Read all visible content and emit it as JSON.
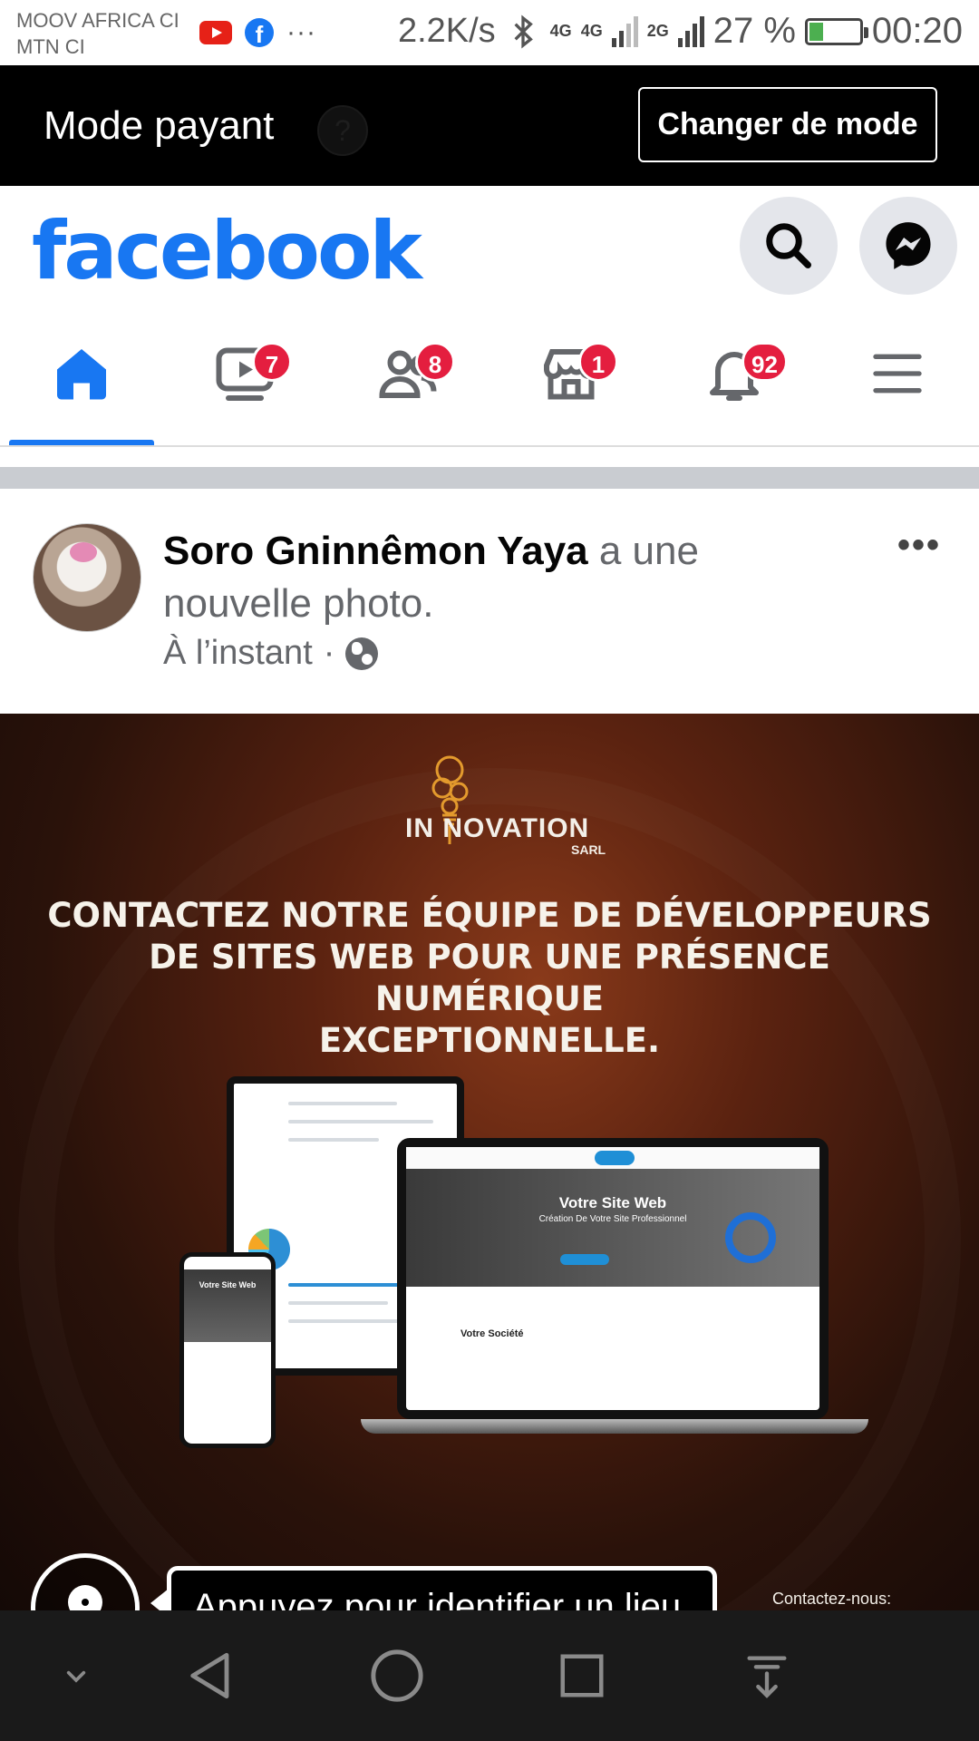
{
  "status_bar": {
    "carrier_1": "MOOV AFRICA CI",
    "carrier_2": "MTN CI",
    "speed": "2.2K/s",
    "net_1": "4G",
    "net_2": "4G",
    "net_3": "2G",
    "battery": "27 %",
    "time": "00:20"
  },
  "mode_bar": {
    "title": "Mode payant",
    "help": "?",
    "button": "Changer de mode"
  },
  "header": {
    "logo": "facebook",
    "brand_color": "#1877f2"
  },
  "nav": {
    "tabs": [
      {
        "name": "home",
        "badge": ""
      },
      {
        "name": "watch",
        "badge": "7"
      },
      {
        "name": "friends",
        "badge": "8"
      },
      {
        "name": "marketplace",
        "badge": "1"
      },
      {
        "name": "notifications",
        "badge": "92"
      },
      {
        "name": "menu",
        "badge": ""
      }
    ],
    "active_tab": "home"
  },
  "post": {
    "author": "Soro Gninnêmon Yaya",
    "action": " a une nouvelle photo.",
    "time": "À l’instant",
    "separator": "·",
    "privacy_icon": "globe-icon",
    "more": "•••"
  },
  "ad": {
    "brand_prefix": "IN",
    "brand": "NOVATION",
    "brand_suffix": "SARL",
    "headline_1": "CONTACTEZ NOTRE ÉQUIPE DE DÉVELOPPEURS",
    "headline_2": "DE SITES WEB POUR UNE PRÉSENCE NUMÉRIQUE",
    "headline_3": "EXCEPTIONNELLE.",
    "screen_title": "Votre Site Web",
    "screen_subtitle": "Création De Votre Site Professionnel",
    "screen_section": "Votre Société",
    "phone_title": "Votre Site Web",
    "contact": "Contactez-nous:"
  },
  "tag_hint": "Appuyez pour identifier un lieu"
}
